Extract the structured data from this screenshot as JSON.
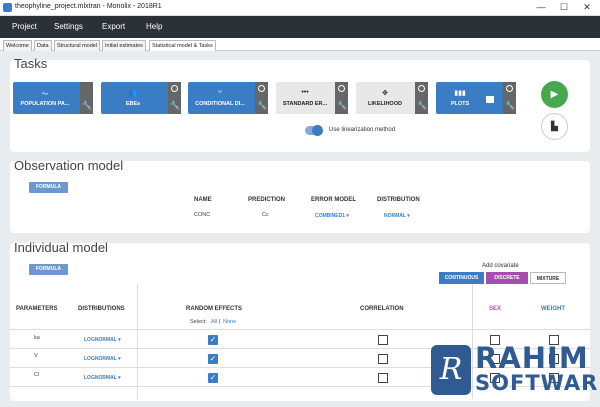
{
  "window": {
    "title": "theophyline_project.mlxtran - Monolix - 2018R1",
    "minimize": "—",
    "maximize": "☐",
    "close": "✕"
  },
  "menu": [
    "Project",
    "Settings",
    "Export",
    "Help"
  ],
  "tabs": [
    "Welcome",
    "Data",
    "Structural model",
    "Initial estimates",
    "Statistical model & Tasks"
  ],
  "tasks": {
    "title": "Tasks",
    "items": [
      {
        "label": "POPULATION PA...",
        "icon": "trend-icon",
        "glyph": "〜"
      },
      {
        "label": "EBEs",
        "icon": "users-icon",
        "glyph": "👥"
      },
      {
        "label": "CONDITIONAL DI...",
        "icon": "fork-icon",
        "glyph": "⑂"
      },
      {
        "label": "STANDARD ER...",
        "icon": "dots-icon",
        "glyph": "•••"
      },
      {
        "label": "LIKELIHOOD",
        "icon": "move-icon",
        "glyph": "✥"
      },
      {
        "label": "PLOTS",
        "icon": "bar-chart-icon",
        "glyph": "▮▮▮"
      }
    ],
    "run_glyph": "▶",
    "chart_glyph": "▙",
    "wrench": "🔧",
    "linearization_label": "Use linearization method"
  },
  "observation": {
    "title": "Observation model",
    "formula_button": "FORMULA",
    "headers": [
      "NAME",
      "PREDICTION",
      "ERROR MODEL",
      "DISTRIBUTION"
    ],
    "row": {
      "name": "CONC",
      "prediction": "Cc",
      "error_model": "COMBINED1 ▾",
      "distribution": "NORMAL ▾"
    }
  },
  "individual": {
    "title": "Individual model",
    "formula_button": "FORMULA",
    "add_covariate": "Add covariate",
    "covariate_buttons": [
      "CONTINUOUS",
      "DISCRETE",
      "MIXTURE"
    ],
    "headers": {
      "parameters": "PARAMETERS",
      "distributions": "DISTRIBUTIONS",
      "random_effects": "RANDOM EFFECTS",
      "correlation": "CORRELATION",
      "sex": "SEX",
      "weight": "WEIGHT"
    },
    "select": "Select:",
    "select_all": "All",
    "select_sep": "|",
    "select_none": "None",
    "check": "✓",
    "rows": [
      {
        "param": "ka",
        "distribution": "LOGNORMAL ▾"
      },
      {
        "param": "V",
        "distribution": "LOGNORMAL ▾"
      },
      {
        "param": "Cl",
        "distribution": "LOGNORMAL ▾"
      }
    ]
  },
  "watermark": {
    "glyph": "R",
    "line1": "RAHIM",
    "line2": "SOFTWARES"
  }
}
